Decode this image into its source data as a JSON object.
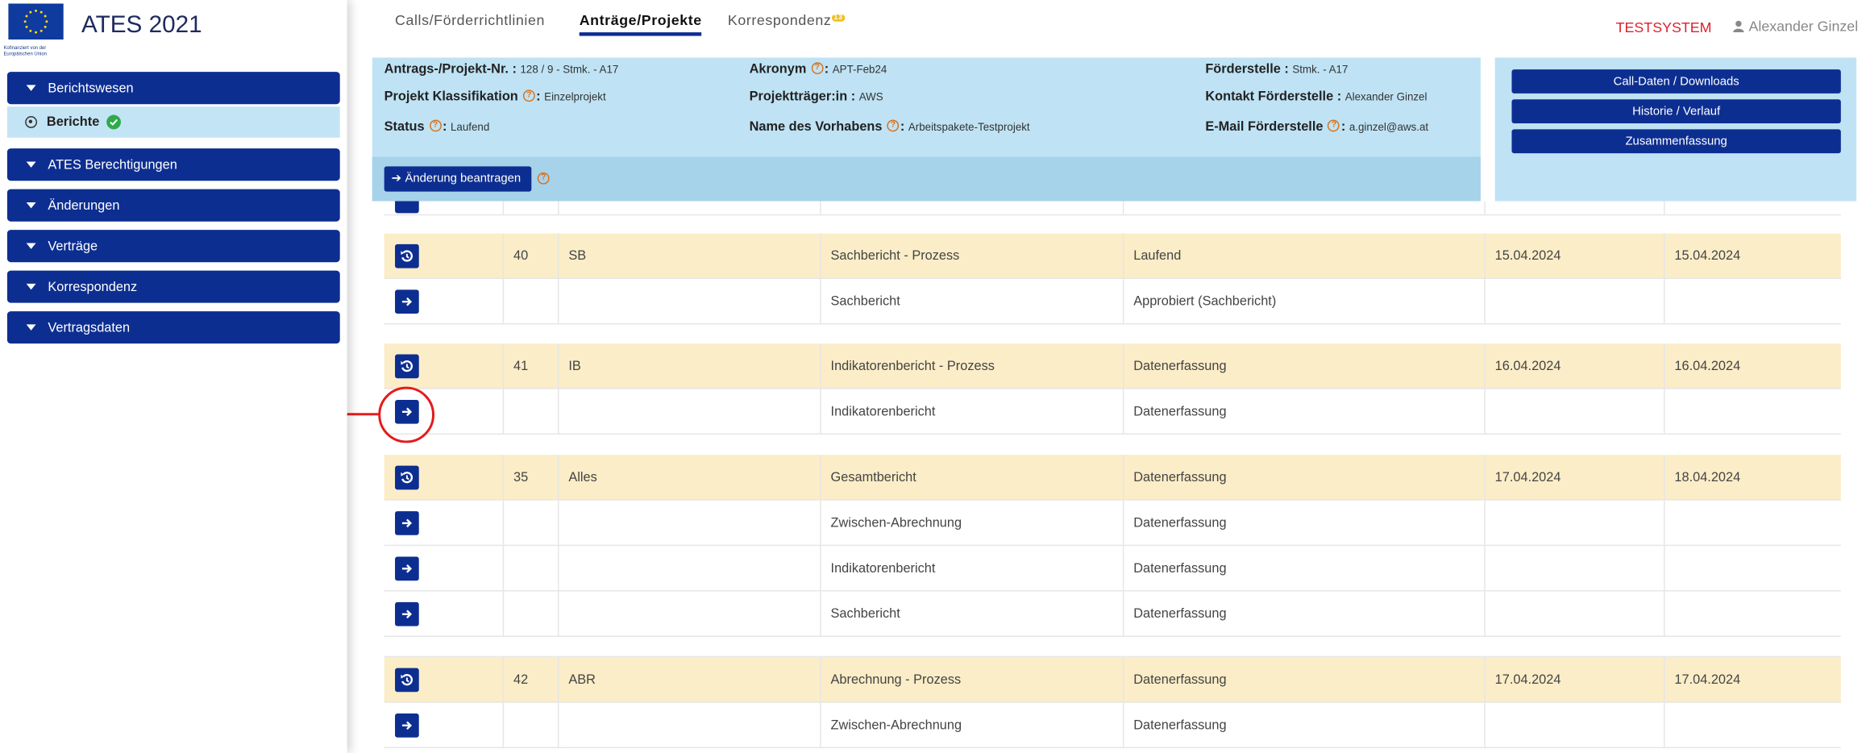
{
  "sidebar": {
    "app_title": "ATES 2021",
    "eu_caption": "Kofinanziert von der Europäischen Union",
    "items": [
      {
        "label": "Berichtswesen"
      },
      {
        "label": "ATES Berechtigungen"
      },
      {
        "label": "Änderungen"
      },
      {
        "label": "Verträge"
      },
      {
        "label": "Korrespondenz"
      },
      {
        "label": "Vertragsdaten"
      }
    ],
    "sub_item": {
      "label": "Berichte"
    }
  },
  "topnav": {
    "tabs": [
      {
        "label": "Calls/Förderrichtlinien"
      },
      {
        "label": "Anträge/Projekte"
      },
      {
        "label": "Korrespondenz"
      }
    ],
    "active_tab": "Anträge/Projekte",
    "korrespondenz_badge": "13",
    "environment": "TESTSYSTEM",
    "user_name": "Alexander Ginzel"
  },
  "info": {
    "antrag_label": "Antrags-/Projekt-Nr. :",
    "antrag_value": "128 / 9 - Stmk. - A17",
    "klass_label": "Projekt Klassifikation",
    "klass_value": "Einzelprojekt",
    "status_label": "Status",
    "status_value": "Laufend",
    "akronym_label": "Akronym",
    "akronym_value": "APT-Feb24",
    "traeger_label": "Projektträger:in :",
    "traeger_value": "AWS",
    "vorhaben_label": "Name des Vorhabens",
    "vorhaben_value": "Arbeitspakete-Testprojekt",
    "foerderstelle_label": "Förderstelle :",
    "foerderstelle_value": "Stmk. - A17",
    "kontakt_label": "Kontakt Förderstelle :",
    "kontakt_value": "Alexander Ginzel",
    "email_label": "E-Mail Förderstelle",
    "email_value": "a.ginzel@aws.at",
    "change_button": "Änderung beantragen"
  },
  "actions": {
    "call_daten": "Call-Daten / Downloads",
    "historie": "Historie / Verlauf",
    "zusammenfassung": "Zusammenfassung"
  },
  "table": {
    "rows": [
      {
        "hl": true,
        "icon": "history-icon",
        "nr": "40",
        "kuerzel": "SB",
        "bericht": "Sachbericht - Prozess",
        "status": "Laufend",
        "von": "15.04.2024",
        "bis": "15.04.2024"
      },
      {
        "hl": false,
        "icon": "arrow-right-icon",
        "nr": "",
        "kuerzel": "",
        "bericht": "Sachbericht",
        "status": "Approbiert (Sachbericht)",
        "von": "",
        "bis": ""
      },
      {
        "hl": true,
        "icon": "history-icon",
        "nr": "41",
        "kuerzel": "IB",
        "bericht": "Indikatorenbericht - Prozess",
        "status": "Datenerfassung",
        "von": "16.04.2024",
        "bis": "16.04.2024"
      },
      {
        "hl": false,
        "icon": "arrow-right-icon",
        "nr": "",
        "kuerzel": "",
        "bericht": "Indikatorenbericht",
        "status": "Datenerfassung",
        "von": "",
        "bis": ""
      },
      {
        "hl": true,
        "icon": "history-icon",
        "nr": "35",
        "kuerzel": "Alles",
        "bericht": "Gesamtbericht",
        "status": "Datenerfassung",
        "von": "17.04.2024",
        "bis": "18.04.2024"
      },
      {
        "hl": false,
        "icon": "arrow-right-icon",
        "nr": "",
        "kuerzel": "",
        "bericht": "Zwischen-Abrechnung",
        "status": "Datenerfassung",
        "von": "",
        "bis": ""
      },
      {
        "hl": false,
        "icon": "arrow-right-icon",
        "nr": "",
        "kuerzel": "",
        "bericht": "Indikatorenbericht",
        "status": "Datenerfassung",
        "von": "",
        "bis": ""
      },
      {
        "hl": false,
        "icon": "arrow-right-icon",
        "nr": "",
        "kuerzel": "",
        "bericht": "Sachbericht",
        "status": "Datenerfassung",
        "von": "",
        "bis": ""
      },
      {
        "hl": true,
        "icon": "history-icon",
        "nr": "42",
        "kuerzel": "ABR",
        "bericht": "Abrechnung - Prozess",
        "status": "Datenerfassung",
        "von": "17.04.2024",
        "bis": "17.04.2024"
      },
      {
        "hl": false,
        "icon": "arrow-right-icon",
        "nr": "",
        "kuerzel": "",
        "bericht": "Zwischen-Abrechnung",
        "status": "Datenerfassung",
        "von": "",
        "bis": ""
      }
    ]
  }
}
